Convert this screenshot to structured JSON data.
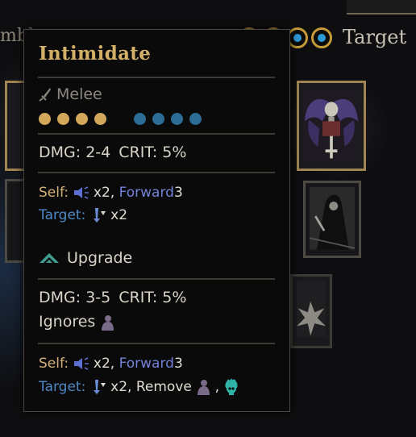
{
  "background": {
    "partial_label": "mbl",
    "target_label": "Target"
  },
  "tooltip": {
    "title": "Intimidate",
    "skill_type": "Melee",
    "rank_positions": 4,
    "target_positions": 4,
    "base": {
      "dmg": "DMG: 2-4",
      "crit": "CRIT: 5%"
    },
    "base_effects": {
      "self_label": "Self:",
      "self_stealth": "x2,",
      "self_forward": "Forward",
      "self_forward_amount": "3",
      "target_label": "Target:",
      "target_debuff": "x2"
    },
    "upgrade_label": "Upgrade",
    "upgraded": {
      "dmg": "DMG: 3-5",
      "crit": "CRIT: 5%",
      "ignores_label": "Ignores"
    },
    "upgraded_effects": {
      "self_label": "Self:",
      "self_stealth": "x2,",
      "self_forward": "Forward",
      "self_forward_amount": "3",
      "target_label": "Target:",
      "target_debuff": "x2, Remove",
      "comma": ","
    },
    "colors": {
      "title": "#d3b068",
      "rank_dot": "#d3a85a",
      "target_dot": "#2c6c95",
      "self_text": "#d2b079",
      "target_text": "#4d88c7",
      "forward_text": "#7381d6"
    },
    "icons": [
      "dagger-icon",
      "stealth-shout-icon",
      "debuff-arrow-icon",
      "upgrade-chevron-icon",
      "guard-figure-icon",
      "skull-flame-icon"
    ]
  }
}
